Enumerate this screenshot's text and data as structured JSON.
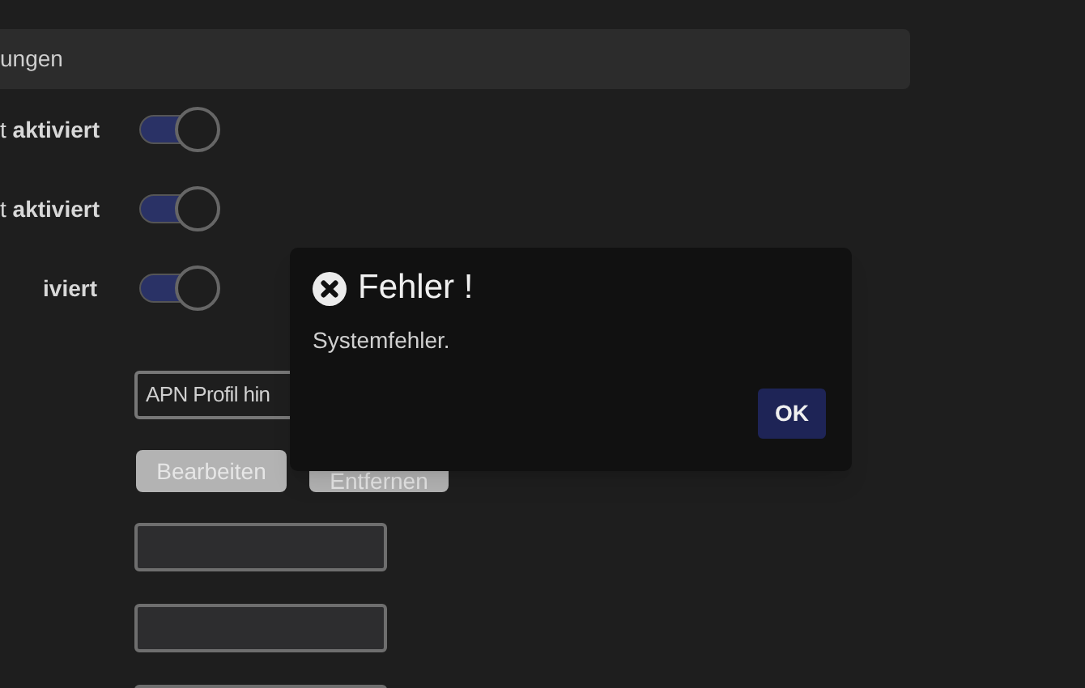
{
  "section_header": {
    "title": "ungen"
  },
  "toggles": [
    {
      "label": "t **aktiviert**",
      "on": true
    },
    {
      "label": "t **aktiviert**",
      "on": true
    },
    {
      "label": "**iviert**",
      "on": true
    }
  ],
  "apn_select": {
    "value": "APN Profil hin"
  },
  "buttons": [
    {
      "label": "Bearbeiten",
      "disabled": true
    },
    {
      "label": "Entfernen",
      "disabled": true
    }
  ],
  "fields": [
    {
      "kind": "text"
    },
    {
      "kind": "text"
    },
    {
      "kind": "text"
    }
  ],
  "dialog": {
    "title": "Fehler !",
    "message": "Systemfehler.",
    "button": "OK"
  }
}
